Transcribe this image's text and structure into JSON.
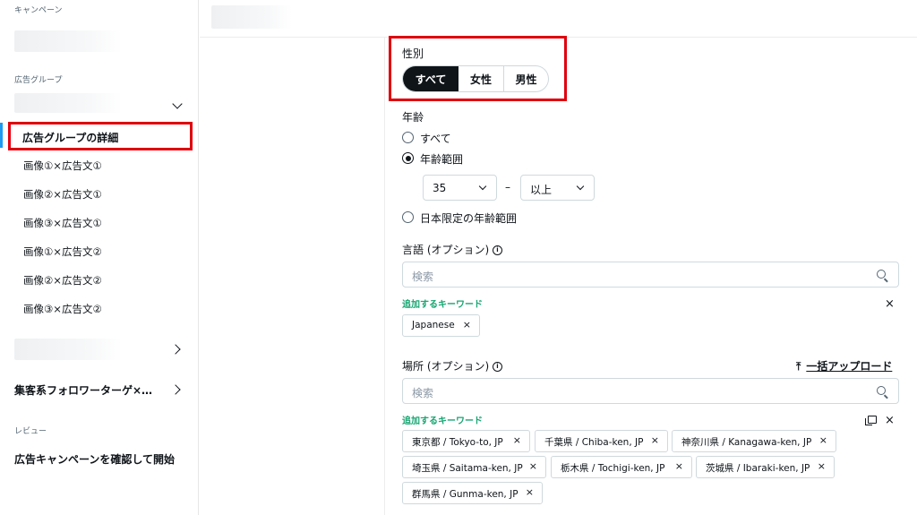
{
  "sidebar": {
    "campaign_label": "キャンペーン",
    "adgroup_label": "広告グループ",
    "adgroup_detail": "広告グループの詳細",
    "ads": [
      "画像①×広告文①",
      "画像②×広告文①",
      "画像③×広告文①",
      "画像①×広告文②",
      "画像②×広告文②",
      "画像③×広告文②"
    ],
    "adgroup2": "集客系フォロワーターゲ×…",
    "review_label": "レビュー",
    "review_item": "広告キャンペーンを確認して開始"
  },
  "gender": {
    "label": "性別",
    "options": [
      "すべて",
      "女性",
      "男性"
    ],
    "selected": "すべて"
  },
  "age": {
    "label": "年齢",
    "options": [
      "すべて",
      "年齢範囲",
      "日本限定の年齢範囲"
    ],
    "selected": "年齢範囲",
    "from_value": "35",
    "to_value": "以上",
    "separator": "–"
  },
  "language": {
    "label": "言語 (オプション)",
    "search_placeholder": "検索",
    "keywords_label": "追加するキーワード",
    "chips": [
      "Japanese"
    ]
  },
  "location": {
    "label": "場所 (オプション)",
    "upload_label": "一括アップロード",
    "search_placeholder": "検索",
    "keywords_label": "追加するキーワード",
    "chips": [
      "東京都 / Tokyo-to, JP",
      "千葉県 / Chiba-ken, JP",
      "神奈川県 / Kanagawa-ken, JP",
      "埼玉県 / Saitama-ken, JP",
      "栃木県 / Tochigi-ken, JP",
      "茨城県 / Ibaraki-ken, JP",
      "群馬県 / Gunma-ken, JP"
    ]
  },
  "icons": {
    "info": "i",
    "close": "×",
    "upload": "⤒"
  },
  "colors": {
    "highlight": "#e0000d",
    "keyword_green": "#17a673",
    "active": "#1d9bf0"
  }
}
